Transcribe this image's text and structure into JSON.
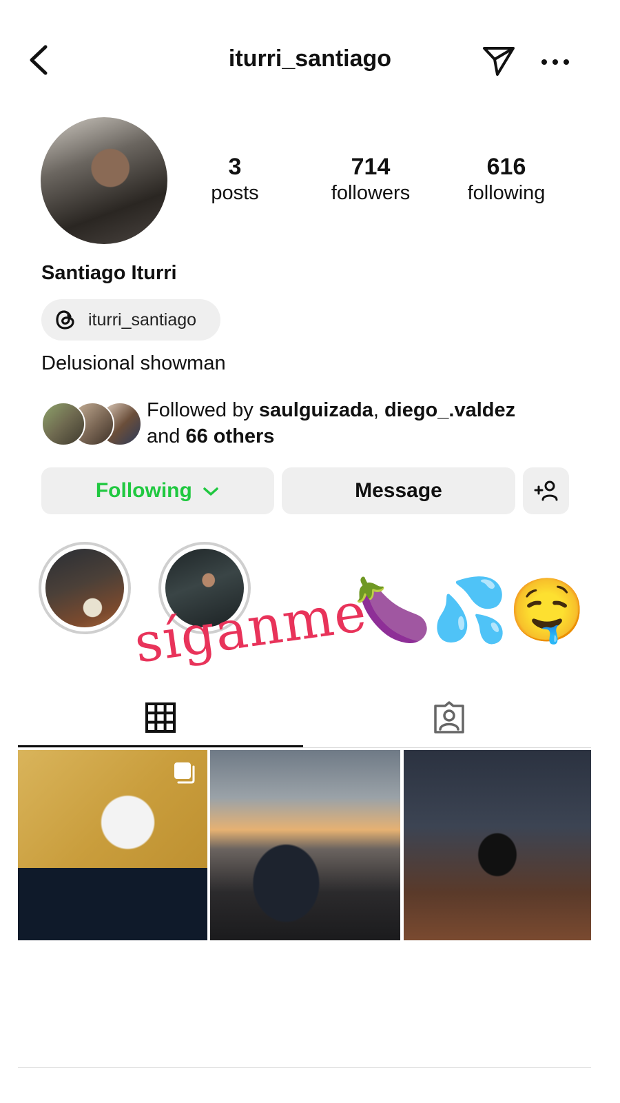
{
  "header": {
    "username": "iturri_santiago"
  },
  "icons": [
    "back-arrow-icon",
    "send-icon",
    "more-icon",
    "threads-icon",
    "chevron-down-icon",
    "add-user-icon",
    "grid-icon",
    "tagged-icon",
    "multiple-photos-icon"
  ],
  "profile": {
    "stats": [
      {
        "value": "3",
        "label": "posts"
      },
      {
        "value": "714",
        "label": "followers"
      },
      {
        "value": "616",
        "label": "following"
      }
    ],
    "display_name": "Santiago Iturri",
    "threads_handle": "iturri_santiago",
    "bio": "Delusional showman",
    "followed_by": {
      "prefix": "Followed by ",
      "user1": "saulguizada",
      "sep": ", ",
      "user2": "diego_.valdez",
      "and": "and ",
      "others": "66 others"
    }
  },
  "actions": {
    "following_label": "Following",
    "message_label": "Message"
  },
  "sticker": {
    "text": "síganme",
    "emoji": "🍆💦🤤"
  },
  "colors": {
    "following_green": "#20c840",
    "button_bg": "#efefef",
    "sticker_pink": "#e8335a"
  }
}
